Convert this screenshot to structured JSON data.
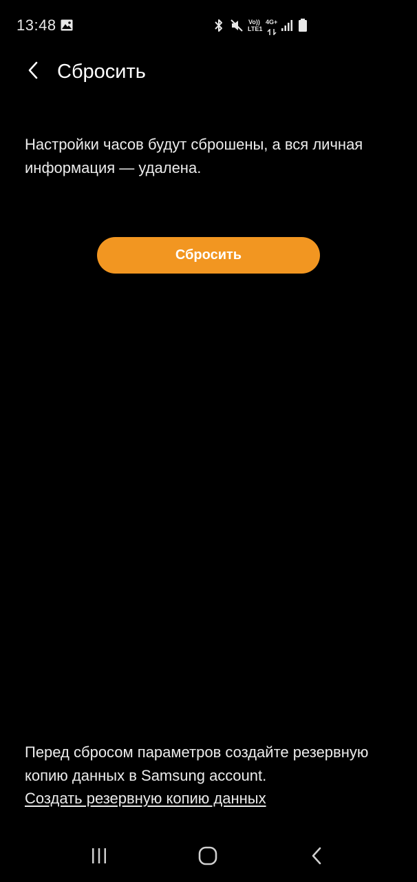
{
  "status_bar": {
    "time": "13:48",
    "volte_label": "Vo))",
    "lte_label": "LTE1",
    "network_label": "4G+",
    "icons": [
      "gallery-icon",
      "bluetooth-icon",
      "mute-icon",
      "volte-icon",
      "4g-icon",
      "signal-icon",
      "battery-icon"
    ]
  },
  "header": {
    "title": "Сбросить",
    "back_icon": "chevron-left-icon"
  },
  "main": {
    "description": "Настройки часов будут сброшены, а вся личная информация — удалена.",
    "reset_button_label": "Сбросить"
  },
  "footer": {
    "backup_text": "Перед сбросом параметров создайте резервную копию данных в Samsung account.",
    "backup_link": "Создать резервную копию данных"
  },
  "nav_bar": {
    "icons": [
      "recent-apps-icon",
      "home-icon",
      "back-icon"
    ]
  },
  "colors": {
    "background": "#000000",
    "accent": "#f29621",
    "text": "#ffffff"
  }
}
